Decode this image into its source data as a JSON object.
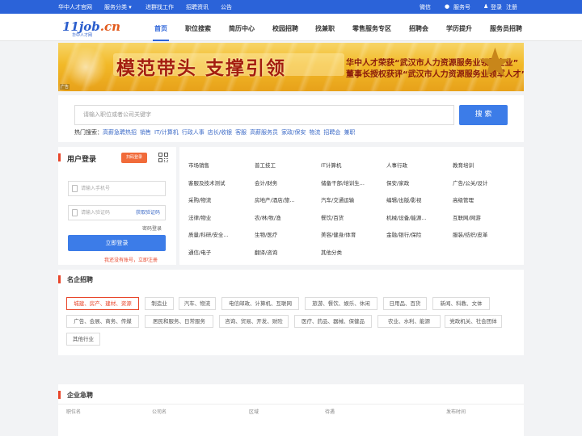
{
  "topbar": {
    "site_name": "华中人才官网",
    "service_category": "服务分类 ▾",
    "enter_group": "进群找工作",
    "recruit_info": "招聘资讯",
    "notice": "公告",
    "wechat": "微信",
    "service_account": "服务号",
    "login": "登录",
    "register": "注册"
  },
  "logo": {
    "text_main": "11job",
    "text_domain": ".cn",
    "text_sub": "华中人才网"
  },
  "nav": {
    "items": [
      "首页",
      "职位搜索",
      "简历中心",
      "校园招聘",
      "找兼职",
      "零售服务专区",
      "招聘会",
      "学历提升",
      "服务员招聘"
    ],
    "active": "首页"
  },
  "banner": {
    "title": "模范带头 支撑引领",
    "line1": "华中人才荣获“武汉市人力资源服务业领军企业”",
    "line2": "董事长授权获评“武汉市人力资源服务业领军人才”",
    "ad_label": "广告"
  },
  "search": {
    "placeholder": "请输入职位或者公司关键字",
    "button": "搜 索",
    "hot_label": "热门搜索：",
    "hot_keywords": [
      "高薪急聘热招",
      "销售",
      "IT/计算机",
      "行政人事",
      "店长/收银",
      "客服",
      "高薪服务员",
      "家政/保安",
      "物流",
      "招聘会",
      "兼职"
    ]
  },
  "login": {
    "title": "用户登录",
    "scan_label": "扫码登录",
    "phone_placeholder": "请输入手机号",
    "code_placeholder": "请输入验证码",
    "get_code": "获取验证码",
    "password_login": "密码登录",
    "login_button": "立即登录",
    "register_prompt": "我还没有账号，立即注册"
  },
  "categories": [
    [
      "市场销售",
      "普工技工",
      "IT计算机",
      "人事行政",
      "教育培训"
    ],
    [
      "客服及技术测试",
      "会计/财务",
      "储备干部/培训生...",
      "保安/家政",
      "广告/公关/设计"
    ],
    [
      "采购/物流",
      "房地产/酒店/旅...",
      "汽车/交通运输",
      "编辑/出版/影视",
      "高级管理"
    ],
    [
      "法律/物业",
      "农/林/牧/渔",
      "餐饮/百货",
      "机械/设备/能源...",
      "互联网/网游"
    ],
    [
      "质量/科研/安全...",
      "生物/医疗",
      "美容/健身/体育",
      "金融/银行/保险",
      "服装/纺织/皮革"
    ],
    [
      "通信/电子",
      "翻译/咨询",
      "其他分类"
    ]
  ],
  "famous": {
    "title": "名企招聘",
    "tags": [
      "城建、房产、建材、资源",
      "制造业",
      "汽车、物流",
      "电信邮政、计算机、互联网",
      "旅游、餐饮、娱乐、休闲",
      "日用品、百货",
      "新闻、科教、文体",
      "广告、会展、商务、传媒",
      "居民和服务、日常服务",
      "咨询、贸易、开发、财险",
      "医疗、药品、器械、保健品",
      "农业、水利、能源",
      "党政机关、社会团体",
      "其他行业"
    ],
    "active_tag": "城建、房产、建材、资源"
  },
  "urgent": {
    "title": "企业急聘",
    "headers": [
      "职位名",
      "公司名",
      "区域",
      "待遇",
      "发布时间"
    ]
  },
  "colors": {
    "primary": "#2b63d9",
    "button": "#3c7ce8",
    "accent": "#e8452a"
  }
}
